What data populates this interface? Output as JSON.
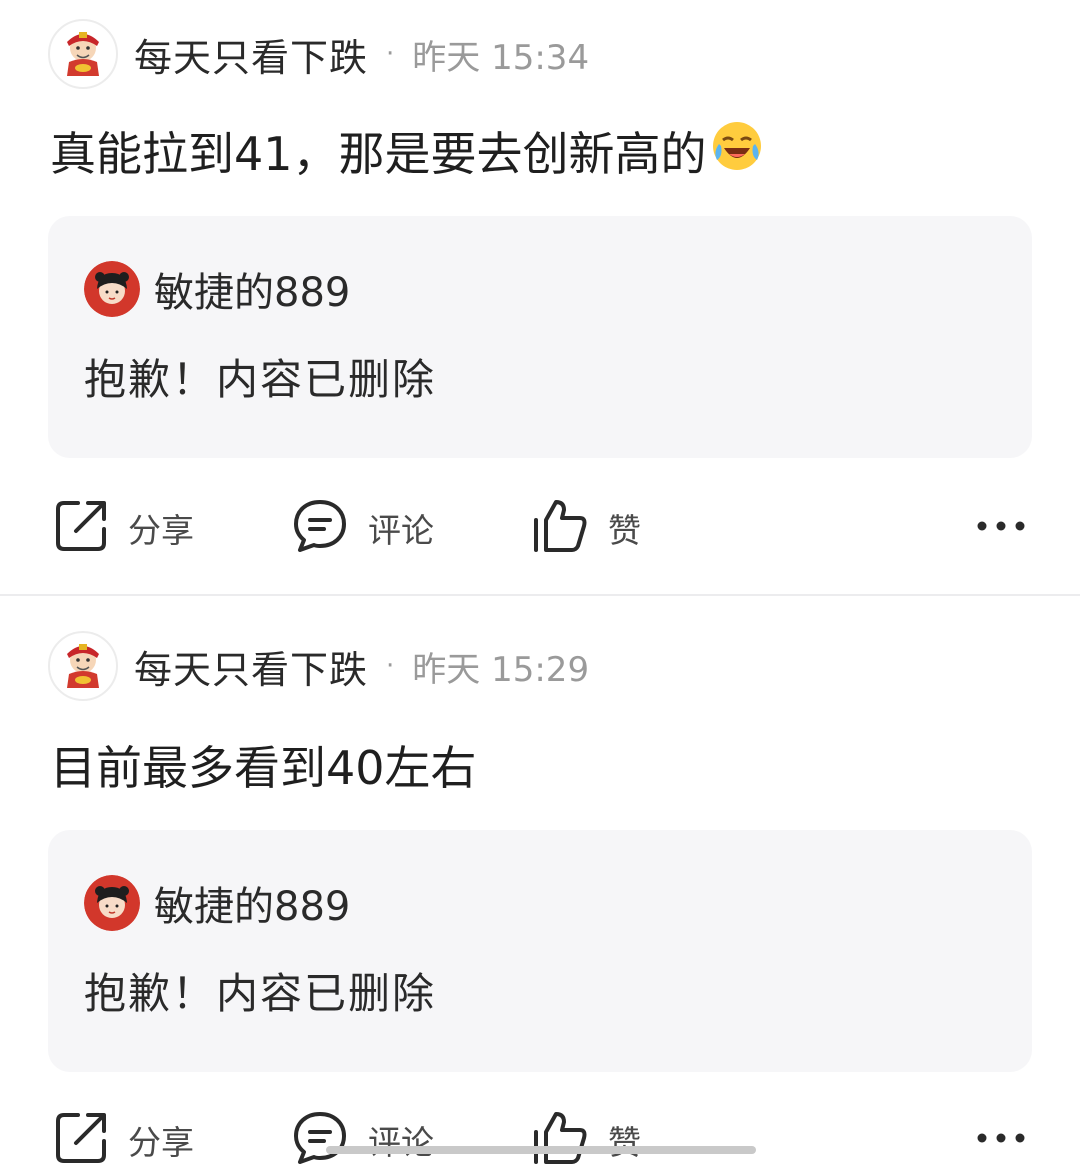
{
  "posts": [
    {
      "author": "每天只看下跌",
      "separator": "·",
      "time": "昨天 15:34",
      "content": "真能拉到41，那是要去创新高的",
      "emoji": "laughing-crying-emoji",
      "quote": {
        "user": "敏捷的889",
        "text": "抱歉！内容已删除"
      },
      "actions": {
        "share": "分享",
        "comment": "评论",
        "like": "赞"
      }
    },
    {
      "author": "每天只看下跌",
      "separator": "·",
      "time": "昨天 15:29",
      "content": "目前最多看到40左右",
      "quote": {
        "user": "敏捷的889",
        "text": "抱歉！内容已删除"
      },
      "actions": {
        "share": "分享",
        "comment": "评论",
        "like": "赞"
      }
    }
  ],
  "icons": {
    "share": "share-icon",
    "comment": "comment-icon",
    "like": "thumbs-up-icon",
    "more": "more-dots-icon"
  },
  "colors": {
    "quote_bg": "#f6f6f8",
    "secondary_text": "#9a9a9a",
    "divider": "#ececee"
  }
}
